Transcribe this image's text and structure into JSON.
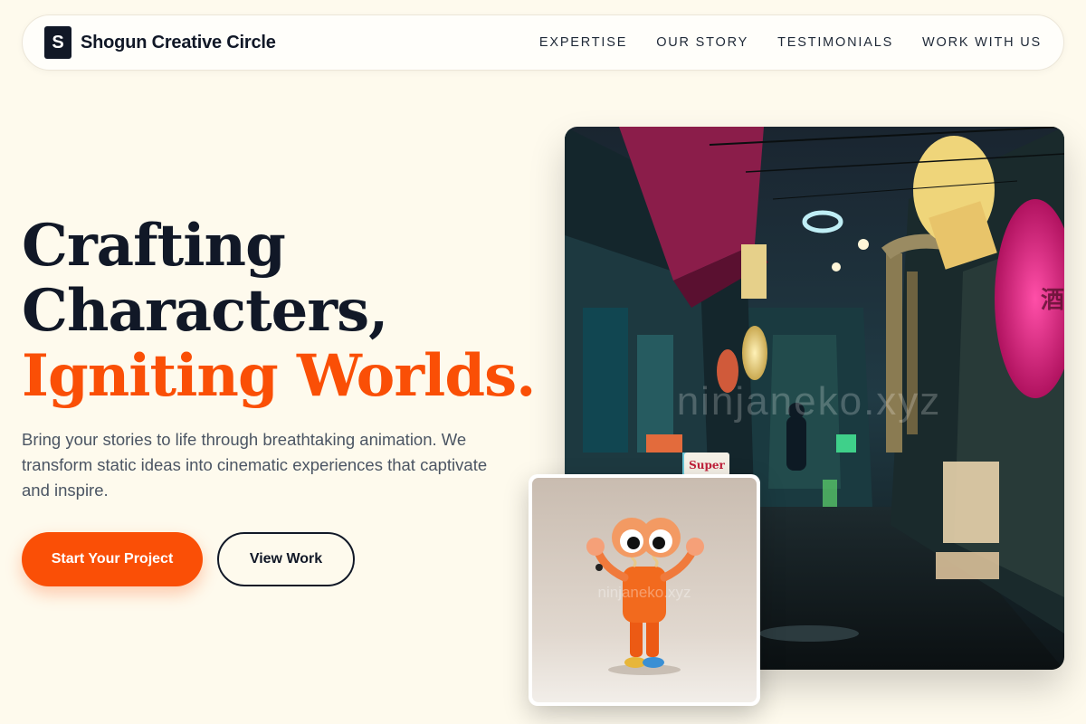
{
  "brand": {
    "logo_letter": "S",
    "name": "Shogun Creative Circle"
  },
  "nav": {
    "links": [
      "EXPERTISE",
      "OUR STORY",
      "TESTIMONIALS",
      "WORK WITH US"
    ]
  },
  "hero": {
    "headline_line1": "Crafting",
    "headline_line2": "Characters,",
    "headline_line3": "Igniting Worlds.",
    "subtext": "Bring your stories to life through breathtaking animation. We transform static ideas into cinematic experiences that captivate and inspire.",
    "primary_cta": "Start Your Project",
    "secondary_cta": "View Work"
  },
  "images": {
    "main_watermark": "ninjaneko.xyz",
    "card_watermark": "ninjaneko.xyz",
    "main_sign": "Super"
  },
  "colors": {
    "background": "#fefaed",
    "accent": "#fa4f06",
    "ink": "#111827",
    "muted_text": "#4b5563"
  }
}
